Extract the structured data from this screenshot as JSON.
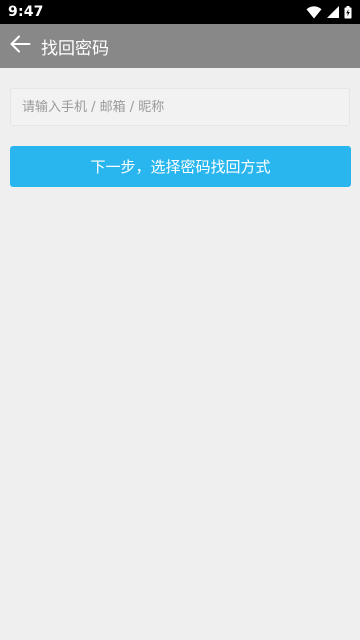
{
  "status_bar": {
    "time": "9:47",
    "icons": [
      "wifi-icon",
      "cellular-signal-icon",
      "battery-charging-icon"
    ]
  },
  "toolbar": {
    "back_icon": "arrow-left-icon",
    "title": "找回密码"
  },
  "form": {
    "account_input": {
      "value": "",
      "placeholder": "请输入手机 / 邮箱 / 昵称"
    },
    "next_button_label": "下一步，选择密码找回方式"
  },
  "colors": {
    "toolbar_bg": "#888888",
    "primary_button": "#29b6ef",
    "page_bg": "#efefef"
  }
}
